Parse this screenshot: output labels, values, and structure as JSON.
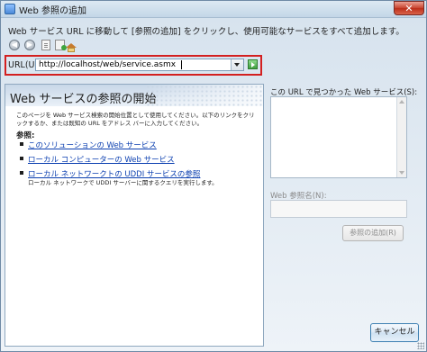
{
  "window": {
    "title": "Web 参照の追加",
    "close_label": "✕"
  },
  "instruction": "Web サービス URL に移動して [参照の追加] をクリックし、使用可能なサービスをすべて追加します。",
  "url_bar": {
    "label": "URL(U):",
    "value": "http://localhost/web/service.asmx"
  },
  "left_pane": {
    "title": "Web サービスの参照の開始",
    "body": "このページを Web サービス検索の開始位置として使用してください。以下のリンクをクリックするか、または既知の URL をアドレス バーに入力してください。",
    "refs_heading": "参照:",
    "links": [
      {
        "label": "このソリューションの Web サービス",
        "sub": ""
      },
      {
        "label": "ローカル コンピューターの Web サービス",
        "sub": ""
      },
      {
        "label": "ローカル ネットワークトの UDDI サービスの参照",
        "sub": "ローカル ネットワークで UDDI サーバーに関するクエリを実行します。"
      }
    ]
  },
  "right_pane": {
    "found_label": "この URL で見つかった Web サービス(S):",
    "ref_name_label": "Web 参照名(N):",
    "add_ref_label": "参照の追加(R)"
  },
  "footer": {
    "cancel_label": "キャンセル"
  },
  "colors": {
    "accent": "#d32020",
    "link": "#0b3fb0"
  }
}
